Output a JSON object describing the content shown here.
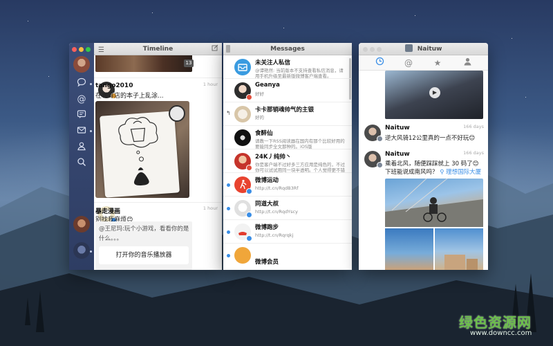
{
  "timeline": {
    "title": "Timeline",
    "topimg_badge": "13",
    "posts": [
      {
        "user": "tango2010",
        "time": "1 hour",
        "text": "在咖啡店的本子上乱涂..."
      },
      {
        "user": "暴走漫画",
        "time": "1 hour",
        "text": "别找我麻烦😊",
        "quote": "@王尼玛:玩个小游戏，看看你的是什么。。。",
        "button": "打开你的音乐播放器"
      }
    ]
  },
  "messages": {
    "title": "Messages",
    "items": [
      {
        "title": "未关注人私信",
        "sub": "@谭艳然: 当前版本不支持查看私信消息，请用手机升级至最新版微博客户端查看。"
      },
      {
        "title": "Geanya",
        "sub": "好好"
      },
      {
        "title": "卡卡那销魂帅气的主银",
        "sub": "好的"
      },
      {
        "title": "食醉仙",
        "sub": "请教一下RSS阅读器在国内有那个比较好用的要能同步全文那种的。iOS版"
      },
      {
        "title": "24K丿纯帅丶",
        "sub": "你是客户端不过好多三方应用是纯色的，不过你可以试试用同一块半透明。个人觉得更不错"
      },
      {
        "title": "微博运动",
        "sub": "http://t.cn/RqdB3Rf"
      },
      {
        "title": "同道大叔",
        "sub": "http://t.cn/RqdYscy"
      },
      {
        "title": "微博跑步",
        "sub": "http://t.cn/Rqrqkj"
      },
      {
        "title": "微博会员",
        "sub": ""
      }
    ]
  },
  "profile": {
    "title": "Naituw",
    "posts": [
      {
        "user": "Naituw",
        "time": "166 days",
        "text": "逆大风骑12公里真的一点不好玩😊"
      },
      {
        "user": "Naituw",
        "time": "166 days",
        "text": "乘着北风，随便踩踩就上 30 码了😊",
        "text2": "下班能说成南风吗？",
        "location": "理想国际大厦"
      }
    ]
  },
  "watermark": {
    "cn": "绿色资源网",
    "url": "www.downcc.com"
  },
  "colors": {
    "accent": "#3a8ee6",
    "rail": "#34456e",
    "unread": "#3a8ee6"
  }
}
